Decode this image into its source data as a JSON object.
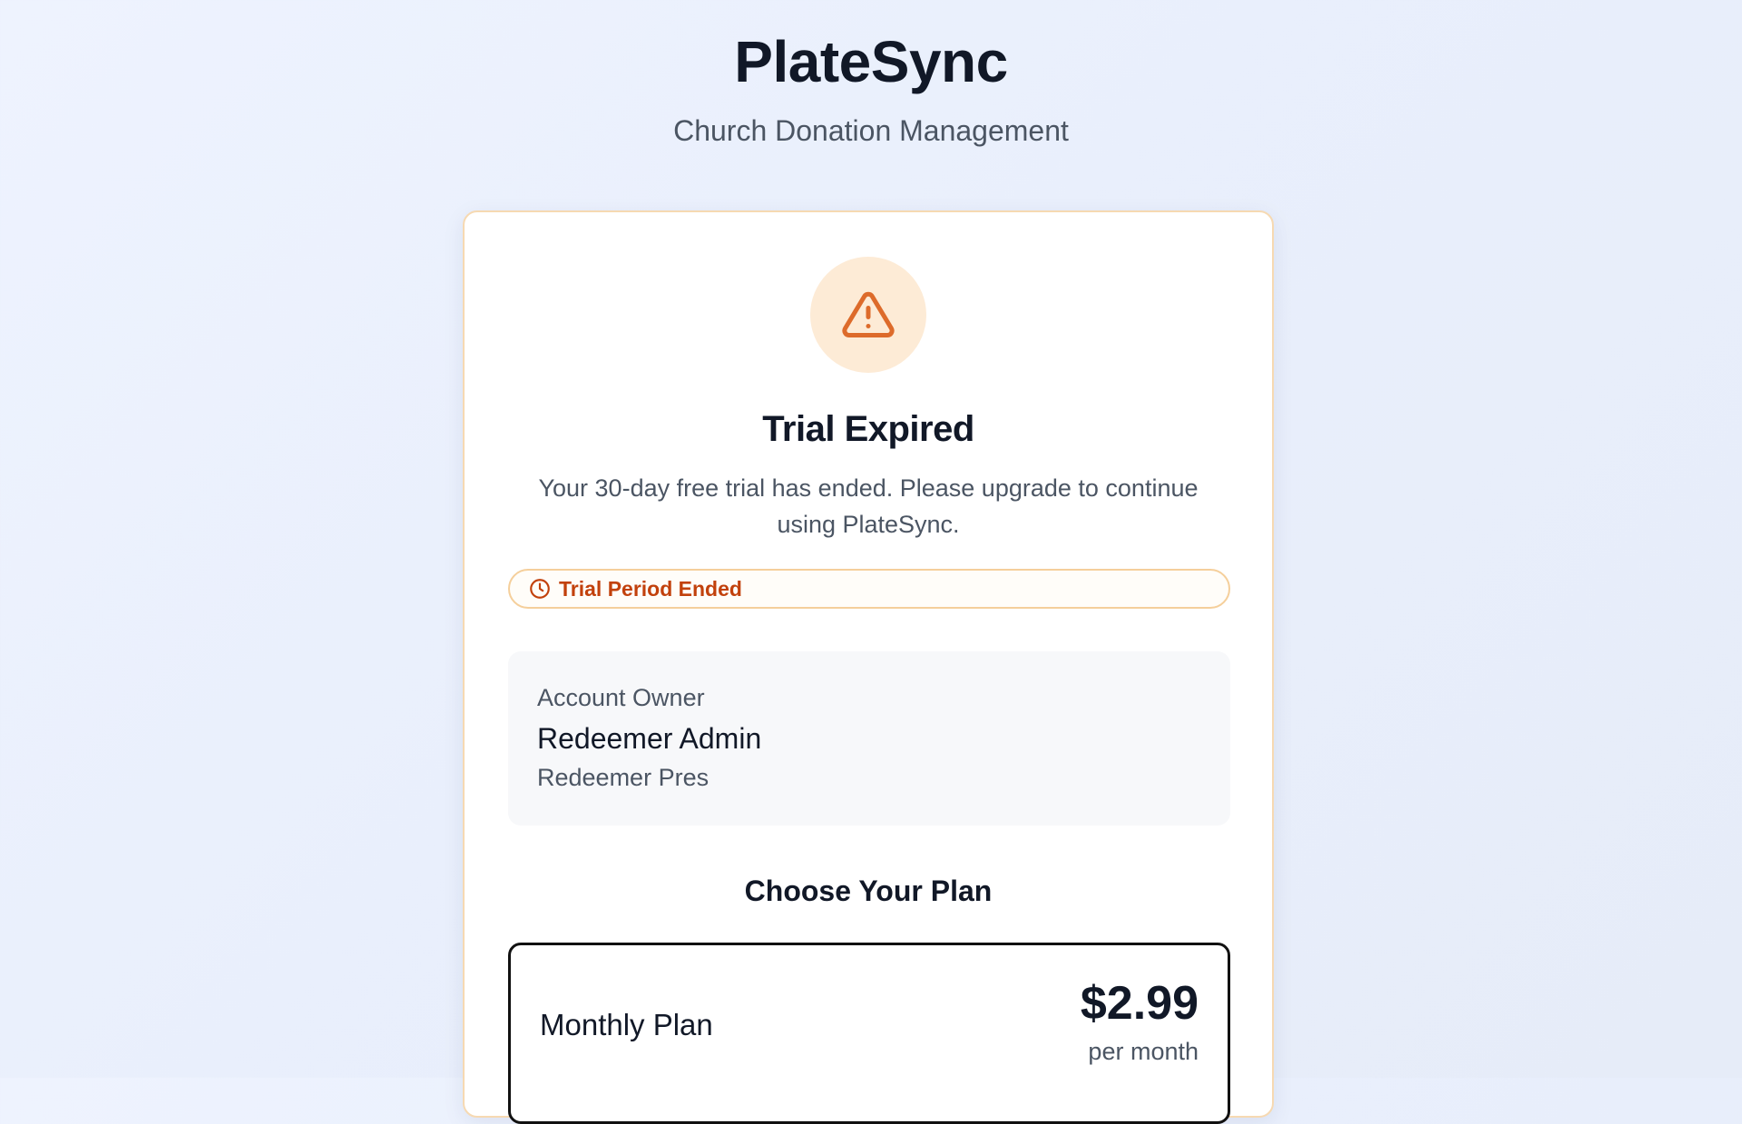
{
  "app": {
    "title": "PlateSync",
    "subtitle": "Church Donation Management"
  },
  "trial": {
    "icon": "warning-triangle-icon",
    "title": "Trial Expired",
    "description": "Your 30-day free trial has ended. Please upgrade to continue using PlateSync.",
    "status_icon": "clock-icon",
    "status_label": "Trial Period Ended"
  },
  "account": {
    "label": "Account Owner",
    "name": "Redeemer Admin",
    "organization": "Redeemer Pres"
  },
  "plans": {
    "heading": "Choose Your Plan",
    "items": [
      {
        "name": "Monthly Plan",
        "price": "$2.99",
        "period": "per month"
      }
    ]
  },
  "colors": {
    "accent": "#c2410c",
    "warning_icon": "#dd6b2b",
    "warning_bg": "#fdebd6",
    "card_border": "#f6d9b2"
  }
}
